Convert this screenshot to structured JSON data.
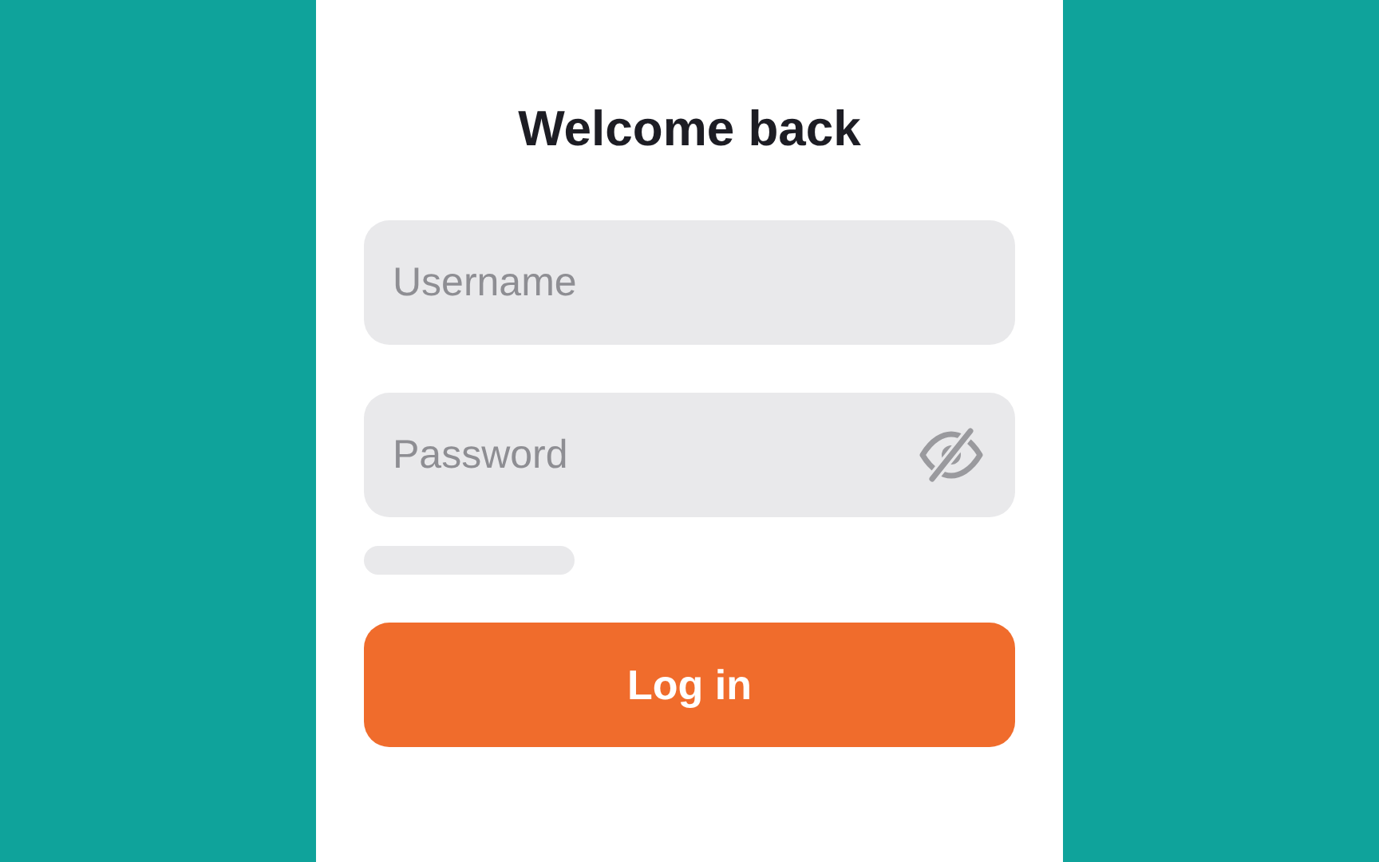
{
  "title": "Welcome back",
  "fields": [
    {
      "placeholder": "Username",
      "kind": "text"
    },
    {
      "placeholder": "Password",
      "kind": "password"
    }
  ],
  "button": "Log in"
}
